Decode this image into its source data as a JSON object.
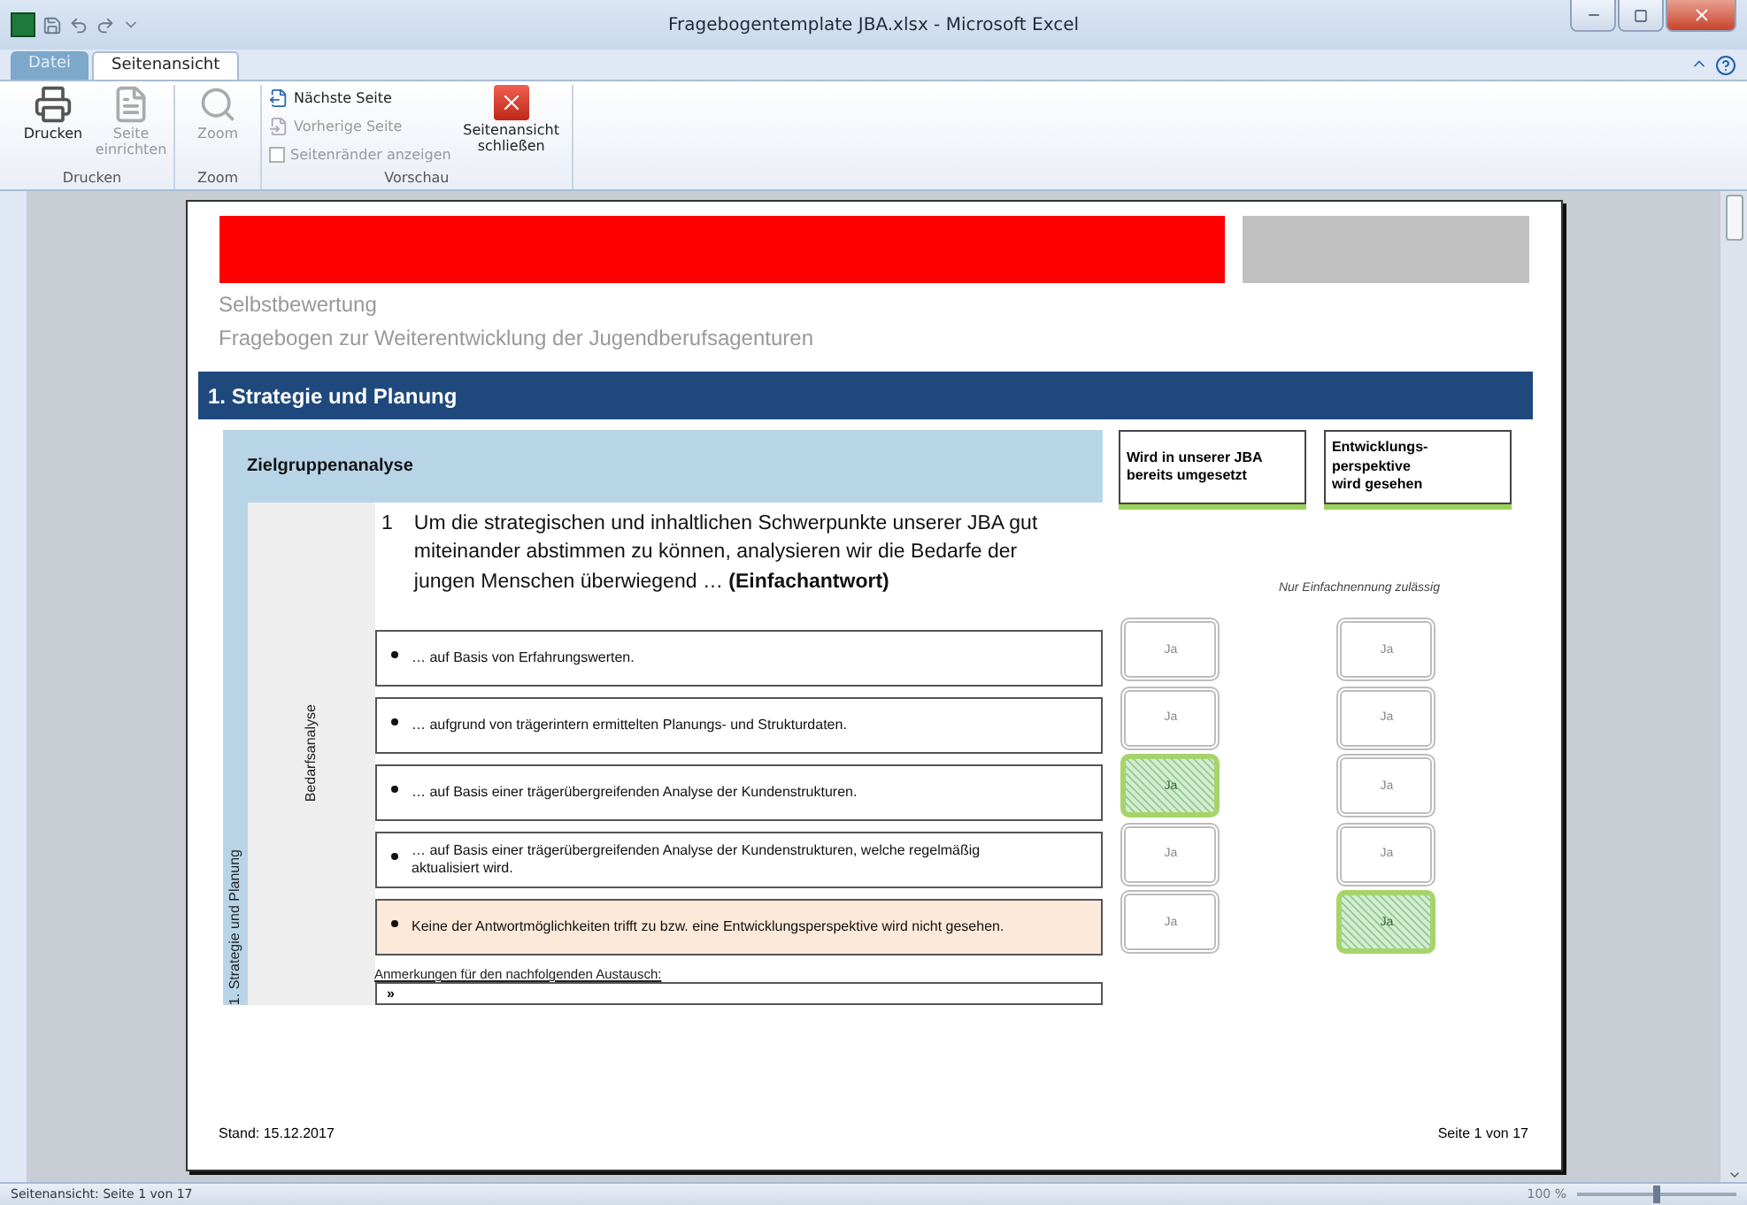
{
  "window": {
    "title": "Fragebogentemplate JBA.xlsx - Microsoft Excel"
  },
  "ribbon_tabs": [
    {
      "label": "Datei",
      "selected": false,
      "kind": "file"
    },
    {
      "label": "Seitenansicht",
      "selected": true,
      "kind": "tab"
    }
  ],
  "ribbon_groups": [
    {
      "label": "Drucken",
      "items": [
        {
          "kind": "large",
          "label": "Drucken",
          "disabled": false
        },
        {
          "kind": "large",
          "label": "Seite einrichten",
          "disabled": true
        }
      ]
    },
    {
      "label": "Zoom",
      "items": [
        {
          "kind": "large",
          "label": "Zoom",
          "disabled": true
        }
      ]
    },
    {
      "label": "Vorschau",
      "items": [
        {
          "kind": "small",
          "label": "Nächste Seite",
          "disabled": false
        },
        {
          "kind": "small",
          "label": "Vorherige Seite",
          "disabled": true
        },
        {
          "kind": "check",
          "label": "Seitenränder anzeigen",
          "disabled": true,
          "checked": false
        },
        {
          "kind": "large",
          "label": "Seitenansicht schließen",
          "disabled": false
        }
      ]
    }
  ],
  "page": {
    "subtitle": "Selbstbewertung",
    "title": "Fragebogen zur Weiterentwicklung der Jugendberufsagenturen",
    "section": "1. Strategie und Planung",
    "side_label": "1. Strategie und Planung",
    "category": "Bedarfsanalyse",
    "subsection": "Zielgruppenanalyse",
    "columns": [
      {
        "lines": [
          "Wird in unserer JBA",
          "bereits umgesetzt"
        ]
      },
      {
        "lines": [
          "Entwicklungs-",
          "perspektive",
          "wird gesehen"
        ]
      }
    ],
    "question": {
      "number": "1",
      "text": "Um die strategischen und inhaltlichen Schwerpunkte unserer JBA gut miteinander abstimmen zu können, analysieren wir die Bedarfe der jungen Menschen überwiegend … **(Einfachantwort)**"
    },
    "note": "Nur Einfachnennung zulässig",
    "options": [
      {
        "text": "… auf Basis von Erfahrungswerten.",
        "highlighted": false,
        "answers": [
          {
            "label": "Ja",
            "selected": false
          },
          {
            "label": "Ja",
            "selected": false
          }
        ]
      },
      {
        "text": "… aufgrund von trägerintern ermittelten Planungs- und Strukturdaten.",
        "highlighted": false,
        "answers": [
          {
            "label": "Ja",
            "selected": false
          },
          {
            "label": "Ja",
            "selected": false
          }
        ]
      },
      {
        "text": "… auf Basis einer trägerübergreifenden Analyse der Kundenstrukturen.",
        "highlighted": false,
        "answers": [
          {
            "label": "Ja",
            "selected": true
          },
          {
            "label": "Ja",
            "selected": false
          }
        ]
      },
      {
        "text": "… auf Basis einer trägerübergreifenden Analyse der Kundenstrukturen, welche regelmäßig aktualisiert wird.",
        "highlighted": false,
        "answers": [
          {
            "label": "Ja",
            "selected": false
          },
          {
            "label": "Ja",
            "selected": false
          }
        ]
      },
      {
        "text": "Keine der Antwortmöglichkeiten trifft zu bzw. eine Entwicklungsperspektive wird nicht gesehen.",
        "highlighted": true,
        "answers": [
          {
            "label": "Ja",
            "selected": false
          },
          {
            "label": "Ja",
            "selected": true
          }
        ]
      }
    ],
    "remarks": {
      "label": "Anmerkungen für den nachfolgenden Austausch:",
      "value": "»"
    },
    "footer": {
      "date": "Stand: 15.12.2017",
      "page": "Seite 1 von 17"
    }
  },
  "status_bar": {
    "text": "Seitenansicht: Seite 1 von 17",
    "zoom": "100 %",
    "zoom_slider": {
      "level": 0.5
    }
  }
}
